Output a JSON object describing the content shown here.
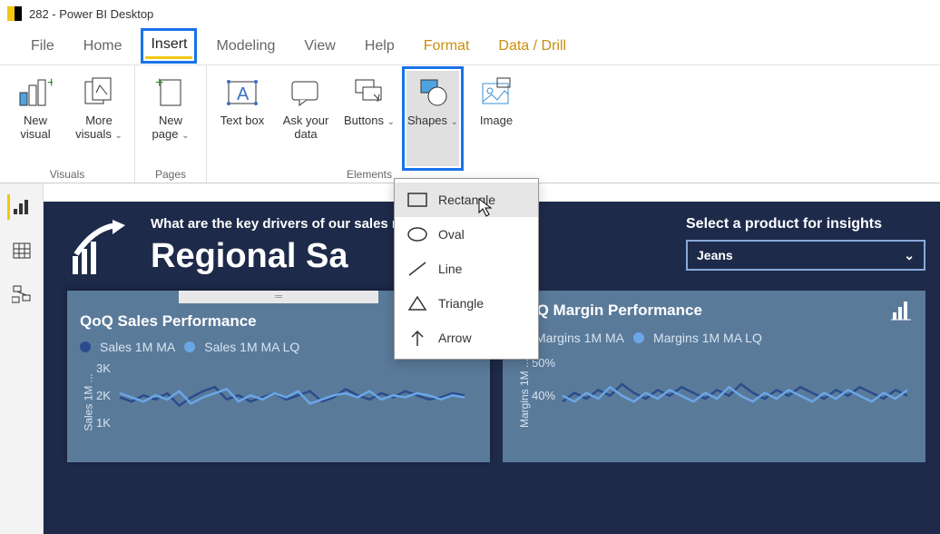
{
  "titlebar": {
    "title": "282 - Power BI Desktop"
  },
  "menu": {
    "file": "File",
    "home": "Home",
    "insert": "Insert",
    "modeling": "Modeling",
    "view": "View",
    "help": "Help",
    "format": "Format",
    "datadrill": "Data / Drill"
  },
  "ribbon": {
    "visuals_group": "Visuals",
    "pages_group": "Pages",
    "elements_group": "Elements",
    "new_visual": "New visual",
    "more_visuals": "More visuals",
    "new_page": "New page",
    "text_box": "Text box",
    "ask_your_data": "Ask your data",
    "buttons": "Buttons",
    "shapes": "Shapes",
    "image": "Image"
  },
  "shapes_menu": {
    "rectangle": "Rectangle",
    "oval": "Oval",
    "line": "Line",
    "triangle": "Triangle",
    "arrow": "Arrow"
  },
  "canvas": {
    "subtitle": "What are the key drivers of our sales results?",
    "title": "Regional Sales Insights",
    "select_label": "Select a product for insights",
    "select_value": "Jeans"
  },
  "chart1": {
    "title": "QoQ Sales Performance",
    "legend1": "Sales 1M MA",
    "legend2": "Sales 1M MA LQ",
    "axis": "Sales 1M ...",
    "ticks": [
      "3K",
      "2K",
      "1K"
    ]
  },
  "chart2": {
    "title": "QoQ Margin Performance",
    "legend1": "Margins 1M MA",
    "legend2": "Margins 1M MA LQ",
    "axis": "Margins 1M ...",
    "ticks": [
      "50%",
      "40%"
    ]
  },
  "chart_data": [
    {
      "type": "line",
      "title": "QoQ Sales Performance",
      "ylabel": "Sales 1M",
      "ylim": [
        0,
        3500
      ],
      "x": [
        0,
        1,
        2,
        3,
        4,
        5,
        6,
        7,
        8,
        9,
        10,
        11,
        12,
        13,
        14,
        15,
        16,
        17,
        18,
        19,
        20,
        21,
        22,
        23,
        24,
        25,
        26,
        27,
        28,
        29
      ],
      "series": [
        {
          "name": "Sales 1M MA",
          "color": "#2b4c8c",
          "values": [
            1900,
            1700,
            2000,
            1800,
            2100,
            1500,
            1900,
            2200,
            2400,
            1800,
            2000,
            1700,
            1900,
            2100,
            1800,
            2000,
            2200,
            1700,
            1900,
            2300,
            2000,
            1800,
            2100,
            1900,
            2200,
            2000,
            1800,
            1900,
            2100,
            2000
          ]
        },
        {
          "name": "Sales 1M MA LQ",
          "color": "#6aa7e6",
          "values": [
            2100,
            1900,
            1700,
            2000,
            1800,
            2200,
            1600,
            1900,
            2100,
            2300,
            1700,
            2000,
            1800,
            2100,
            1900,
            2200,
            1600,
            1800,
            2000,
            2100,
            1900,
            2200,
            1800,
            2000,
            1900,
            2100,
            2000,
            1800,
            2000,
            1900
          ]
        }
      ]
    },
    {
      "type": "line",
      "title": "QoQ Margin Performance",
      "ylabel": "Margins 1M",
      "ylim": [
        0.3,
        0.55
      ],
      "x": [
        0,
        1,
        2,
        3,
        4,
        5,
        6,
        7,
        8,
        9,
        10,
        11,
        12,
        13,
        14,
        15,
        16,
        17,
        18,
        19,
        20,
        21,
        22,
        23,
        24,
        25,
        26,
        27,
        28,
        29
      ],
      "series": [
        {
          "name": "Margins 1M MA",
          "color": "#2b4c8c",
          "values": [
            0.39,
            0.42,
            0.4,
            0.43,
            0.41,
            0.45,
            0.42,
            0.4,
            0.43,
            0.41,
            0.44,
            0.42,
            0.4,
            0.43,
            0.41,
            0.45,
            0.42,
            0.4,
            0.43,
            0.41,
            0.44,
            0.42,
            0.4,
            0.43,
            0.41,
            0.44,
            0.42,
            0.4,
            0.43,
            0.41
          ]
        },
        {
          "name": "Margins 1M MA LQ",
          "color": "#6aa7e6",
          "values": [
            0.41,
            0.39,
            0.42,
            0.4,
            0.44,
            0.41,
            0.39,
            0.42,
            0.4,
            0.43,
            0.41,
            0.39,
            0.42,
            0.4,
            0.44,
            0.41,
            0.39,
            0.42,
            0.4,
            0.43,
            0.41,
            0.39,
            0.42,
            0.4,
            0.43,
            0.41,
            0.39,
            0.42,
            0.4,
            0.43
          ]
        }
      ]
    }
  ]
}
